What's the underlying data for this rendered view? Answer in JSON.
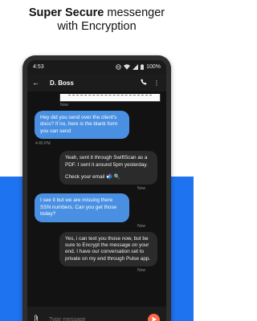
{
  "promo": {
    "line1_bold": "Super Secure",
    "line1_rest": " messenger",
    "line2": "with Encryption"
  },
  "status_bar": {
    "time": "4:53",
    "battery": "100%"
  },
  "conversation": {
    "contact_name": "D. Boss"
  },
  "messages": [
    {
      "direction": "in",
      "type": "image",
      "timestamp": "Now"
    },
    {
      "direction": "out",
      "text": "Hey did you send over the client's docs? If no, here is the blank form you can send",
      "timestamp": "4:45 PM"
    },
    {
      "direction": "in",
      "paragraphs": [
        "Yeah, sent it through SwiftScan as a PDF. I sent it around 5pm yesterday.",
        "Check your email 📬 🔍"
      ],
      "timestamp": "Now"
    },
    {
      "direction": "out",
      "text": "I see it but we are missing there SSN numbers. Can you get those today?",
      "timestamp": "Now"
    },
    {
      "direction": "in",
      "text": "Yes, i can text you those now, but be sure to Encrypt the message on your end. I have our conversation set to private on my end through Pulse app.",
      "timestamp": "Now"
    }
  ],
  "composer": {
    "placeholder": "Type message"
  },
  "colors": {
    "accent_blue": "#1e73f0",
    "outgoing_bubble": "#4a90e2",
    "send_button": "#ff6b45"
  }
}
